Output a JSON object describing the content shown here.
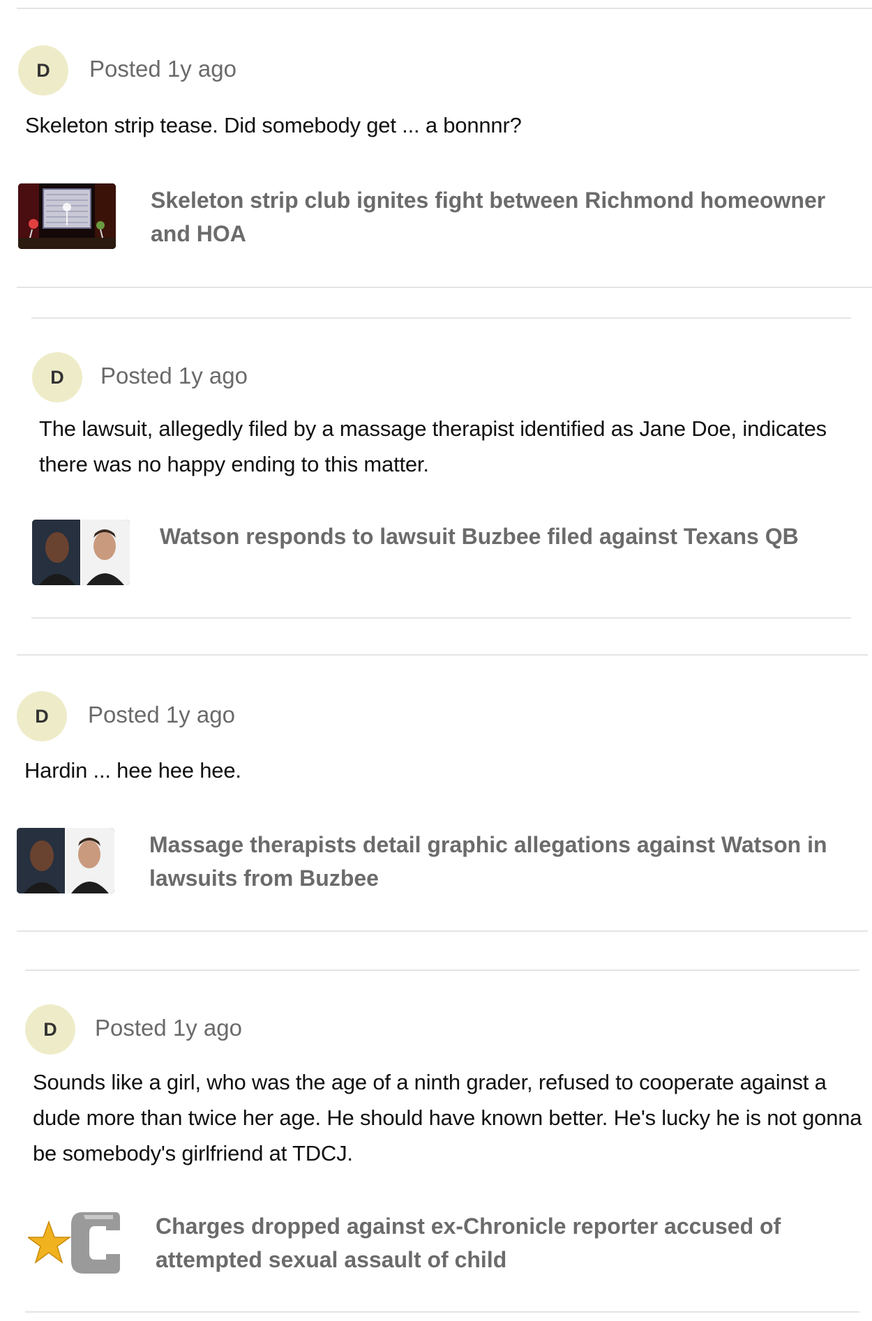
{
  "comments": [
    {
      "avatar_initial": "D",
      "posted": "Posted 1y ago",
      "text": "Skeleton strip tease. Did somebody get ... a bonnnr?",
      "link": {
        "thumb_icon": "skeleton-strip-club-photo",
        "title": "Skeleton strip club ignites fight between Richmond homeowner and HOA"
      }
    },
    {
      "avatar_initial": "D",
      "posted": "Posted 1y ago",
      "text": "The lawsuit, allegedly filed by a massage therapist identified as Jane Doe, indicates there was no happy ending to this matter.",
      "link": {
        "thumb_icon": "watson-buzbee-photo",
        "title": "Watson responds to lawsuit Buzbee filed against Texans QB"
      }
    },
    {
      "avatar_initial": "D",
      "posted": "Posted 1y ago",
      "text": "Hardin ... hee hee hee.",
      "link": {
        "thumb_icon": "watson-buzbee-photo",
        "title": "Massage therapists detail graphic allegations against Watson in lawsuits from Buzbee"
      }
    },
    {
      "avatar_initial": "D",
      "posted": "Posted 1y ago",
      "text": "Sounds like a girl, who was the age of a ninth grader, refused to cooperate against a dude more than twice her age. He should have known better. He's lucky he is not gonna be somebody's girlfriend at TDCJ.",
      "link": {
        "thumb_icon": "chronicle-star-logo",
        "title": "Charges dropped against ex-Chronicle reporter accused of attempted sexual assault of child"
      }
    }
  ],
  "colors": {
    "avatar_bg": "#eeecc8",
    "divider": "#e4e4e4",
    "link_title": "#6b6b6b",
    "meta_text": "#6a6a6a"
  }
}
